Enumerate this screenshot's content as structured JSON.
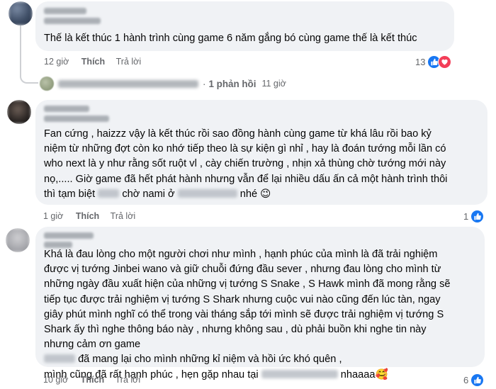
{
  "comments": [
    {
      "text_lines": [
        "Thế là kết thúc 1 hành trình cùng game 6 năm gắng bó cùng game thế là kết thúc"
      ],
      "time": "12 giờ",
      "like_label": "Thích",
      "reply_label": "Trả lời",
      "reaction_count": "13"
    },
    {
      "text_lines": [
        "Fan cứng , haizzz vậy là kết thúc rồi sao đồng hành cùng game từ khá lâu rồi bao kỷ",
        "niệm từ những đợt còn ko nhớ tiếp theo là sự kiện gì nhỉ , hay là đoán tướng mỗi lần có",
        "who next là y như rằng sốt ruột vl , cày chiến trường , nhịn xả thùng chờ tướng mới này",
        "nọ,..... Giờ game đã hết phát hành nhưng vẫn để lại nhiều dấu ấn cả một hành trình thôi"
      ],
      "line5": {
        "a": "thì tạm biệt",
        "b": "chờ nami ở",
        "c": "nhé 😉"
      },
      "time": "1 giờ",
      "like_label": "Thích",
      "reply_label": "Trả lời",
      "reaction_count": "1"
    },
    {
      "text_lines": [
        "Khá là đau lòng cho một người chơi như mình , hạnh phúc của mình là đã trải nghiệm",
        "được vị tướng Jinbei wano và giữ chuỗi đứng đầu sever , nhưng đau lòng cho mình từ",
        "những ngày đầu xuất hiện của những vị tướng S Snake , S Hawk mình đã mong rằng sẽ",
        "tiếp tục được trải nghiệm vị tướng S Shark nhưng cuộc vui nào cũng đến lúc tàn, ngay",
        "giây phút mình nghĩ có thể trong vài tháng sắp tới mình sẽ được trải nghiệm vị tướng S",
        "Shark ấy thì nghe thông báo này , nhưng không sau , dù phải buồn khi nghe tin này",
        "nhưng cảm ơn game"
      ],
      "line8": "đã mang lại cho mình những kỉ niệm và hồi ức khó quên ,",
      "line9": {
        "a": "mình cũng đã rất hạnh phúc , hẹn gặp nhau tại",
        "b": "nhaaaa🥰"
      },
      "time": "10 giờ",
      "like_label": "Thích",
      "reply_label": "Trả lời",
      "reaction_count": "6"
    }
  ],
  "replies_link": {
    "separator": "·",
    "label": "1 phản hồi",
    "time": "11 giờ"
  },
  "colors": {
    "bubble": "#f0f2f5",
    "meta": "#65676b",
    "like": "#1877f2",
    "love": "#f33e58"
  }
}
